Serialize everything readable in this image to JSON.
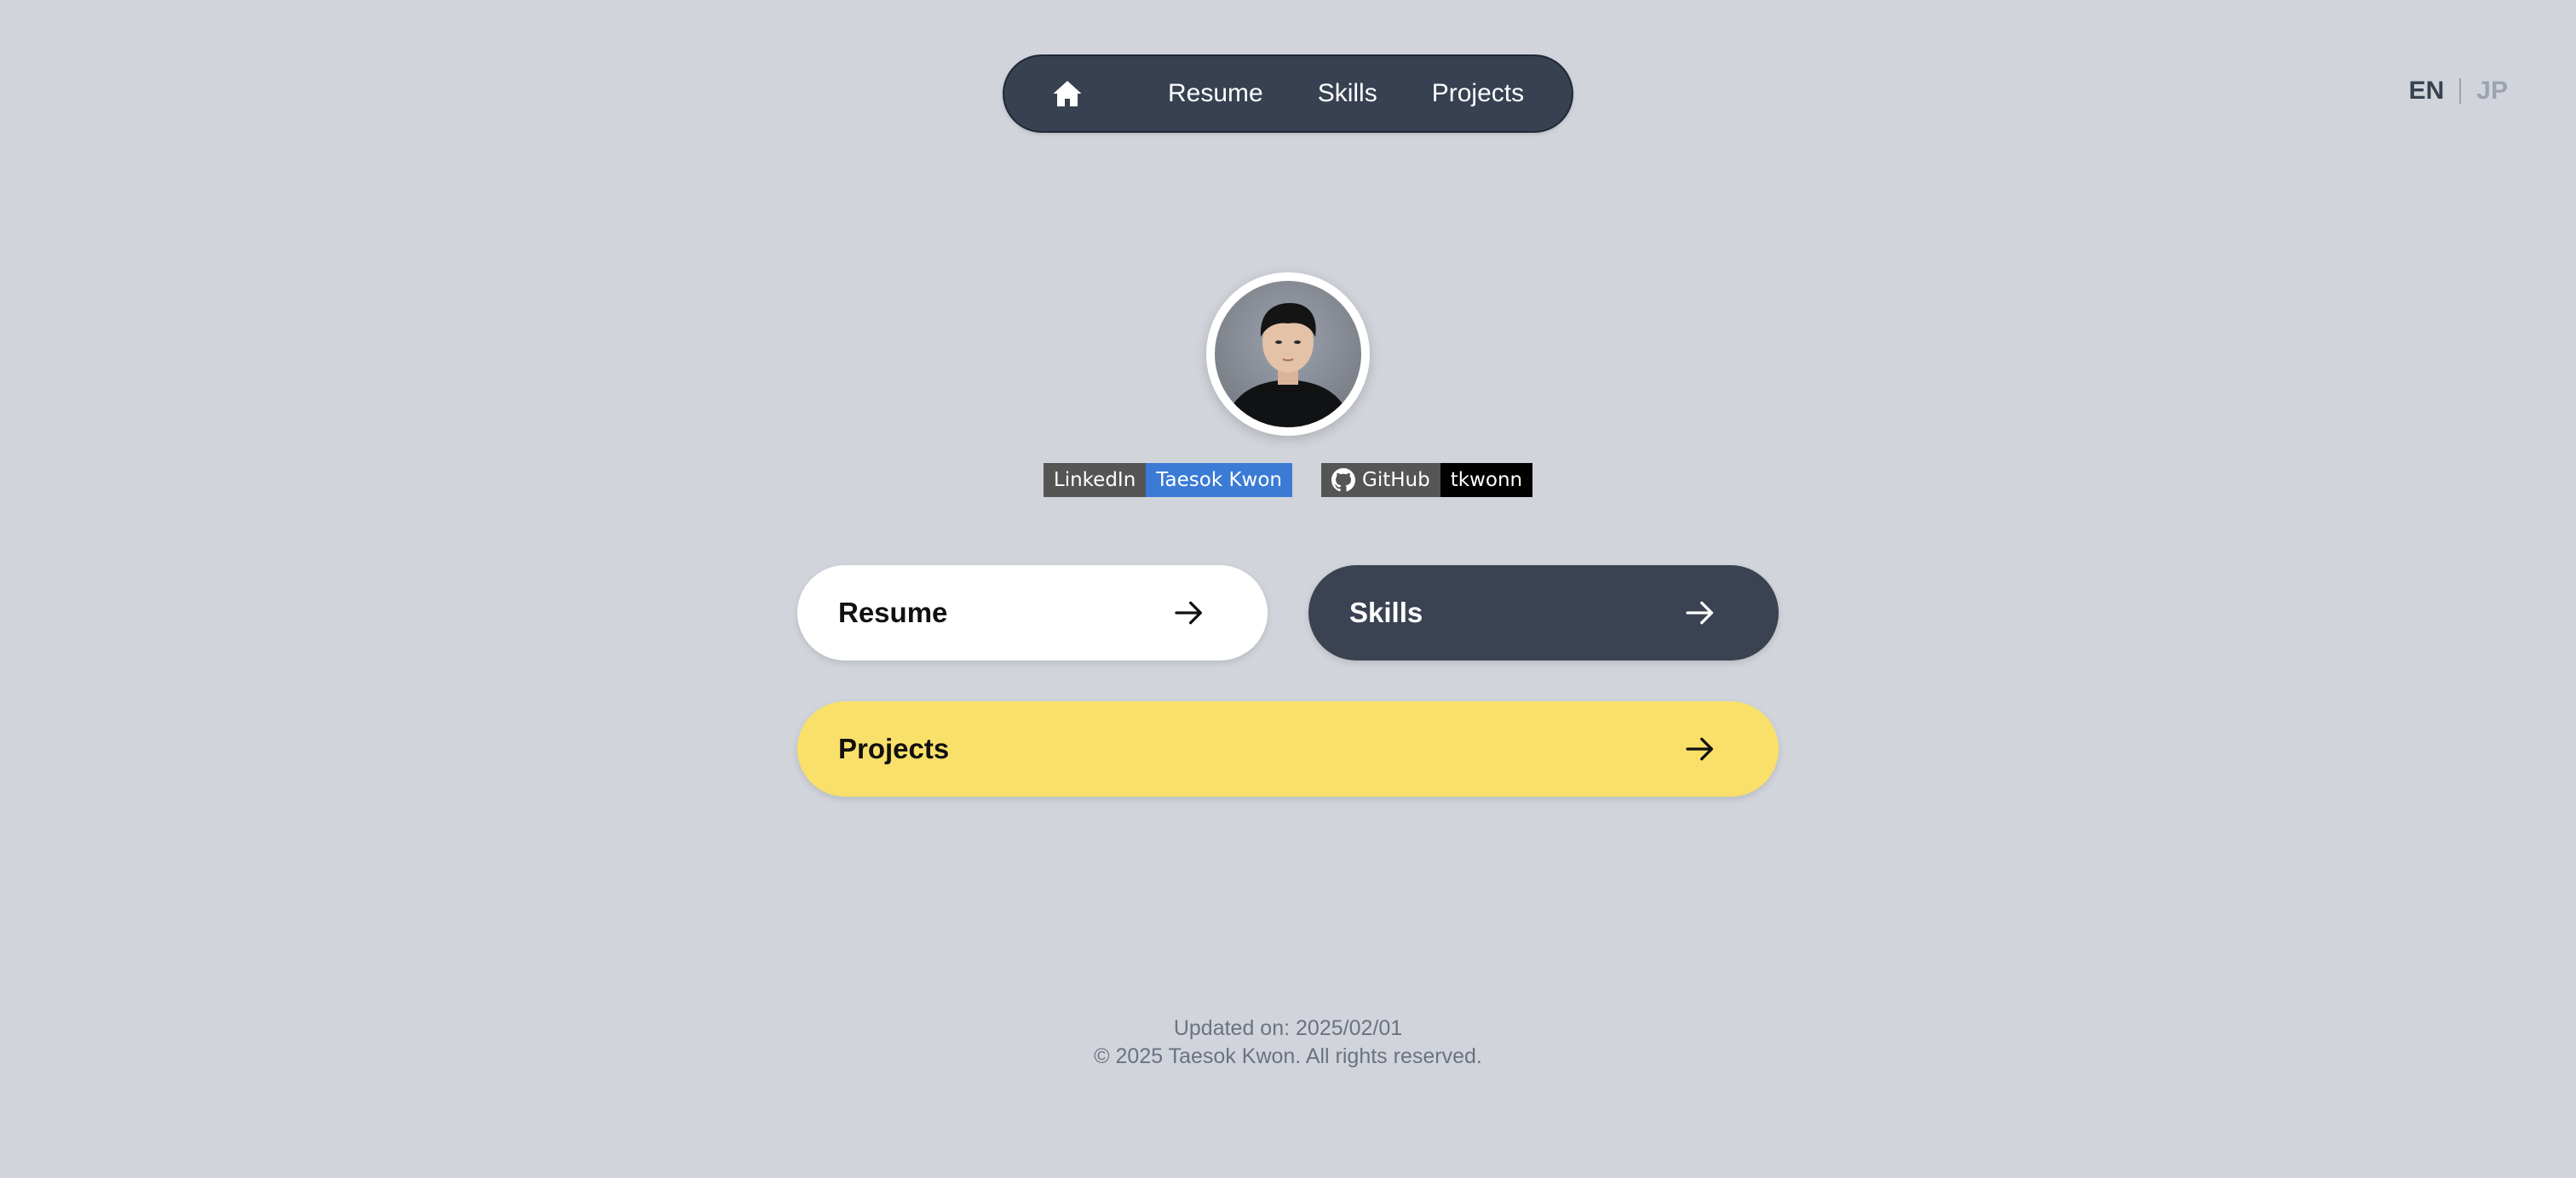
{
  "nav": {
    "home_icon": "home-icon",
    "links": [
      {
        "label": "Resume"
      },
      {
        "label": "Skills"
      },
      {
        "label": "Projects"
      }
    ]
  },
  "language": {
    "active": "EN",
    "inactive": "JP"
  },
  "profile": {
    "avatar": "profile-photo"
  },
  "badges": {
    "linkedin": {
      "label": "LinkedIn",
      "value": "Taesok Kwon",
      "color": "#3b7bd6"
    },
    "github": {
      "label": "GitHub",
      "value": "tkwonn",
      "icon": "github-icon",
      "color": "#000000"
    }
  },
  "buttons": {
    "resume": {
      "label": "Resume",
      "color": "#ffffff"
    },
    "skills": {
      "label": "Skills",
      "color": "#3b4252"
    },
    "projects": {
      "label": "Projects",
      "color": "#f9e06a"
    },
    "arrow_icon": "arrow-right-icon"
  },
  "footer": {
    "updated": "Updated on: 2025/02/01",
    "copyright": "© 2025 Taesok Kwon. All rights reserved."
  },
  "colors": {
    "background": "#d1d5db",
    "nav": "#374151"
  }
}
